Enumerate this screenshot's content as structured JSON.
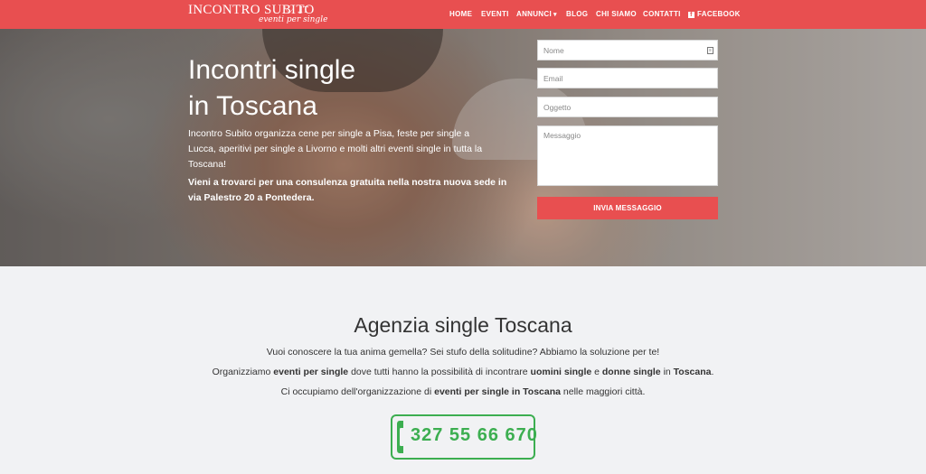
{
  "logo": {
    "main": "INCONTRO SUBITO",
    "tld": ".IT",
    "tagline": "eventi per single"
  },
  "nav": {
    "items": [
      "HOME",
      "EVENTI",
      "ANNUNCI",
      "BLOG",
      "CHI SIAMO",
      "CONTATTI",
      "FACEBOOK"
    ]
  },
  "hero": {
    "title_line1": "Incontri single",
    "title_line2": "in Toscana",
    "text": "Incontro Subito organizza cene per single a Pisa, feste per single a Lucca, aperitivi per single a Livorno e molti altri eventi single in tutta la Toscana!",
    "bold": "Vieni a trovarci per una consulenza gratuita nella nostra nuova sede in via Palestro 20 a Pontedera."
  },
  "form": {
    "name_placeholder": "Nome",
    "email_placeholder": "Email",
    "subject_placeholder": "Oggetto",
    "message_placeholder": "Messaggio",
    "submit_label": "INVIA MESSAGGIO"
  },
  "main": {
    "title": "Agenzia single Toscana",
    "p1": "Vuoi conoscere la tua anima gemella? Sei stufo della solitudine? Abbiamo la soluzione per te!",
    "p2": {
      "a": "Organizziamo ",
      "b": "eventi per single",
      "c": " dove tutti hanno la possibilità di incontrare ",
      "d": "uomini single",
      "e": " e ",
      "f": "donne single",
      "g": " in ",
      "h": "Toscana",
      "i": "."
    },
    "p3": {
      "a": "Ci occupiamo dell'organizzazione di ",
      "b": "eventi per single in Toscana",
      "c": " nelle maggiori città."
    },
    "phone": "327 55 66 670"
  },
  "colors": {
    "brand": "#e84f50",
    "phone_green": "#3cae50",
    "background": "#f1f2f4"
  },
  "icons": {
    "heart": "heart-icon",
    "facebook": "facebook-icon",
    "chevron": "chevron-down-icon",
    "contact_card": "contact-card-icon",
    "phone": "phone-icon"
  }
}
